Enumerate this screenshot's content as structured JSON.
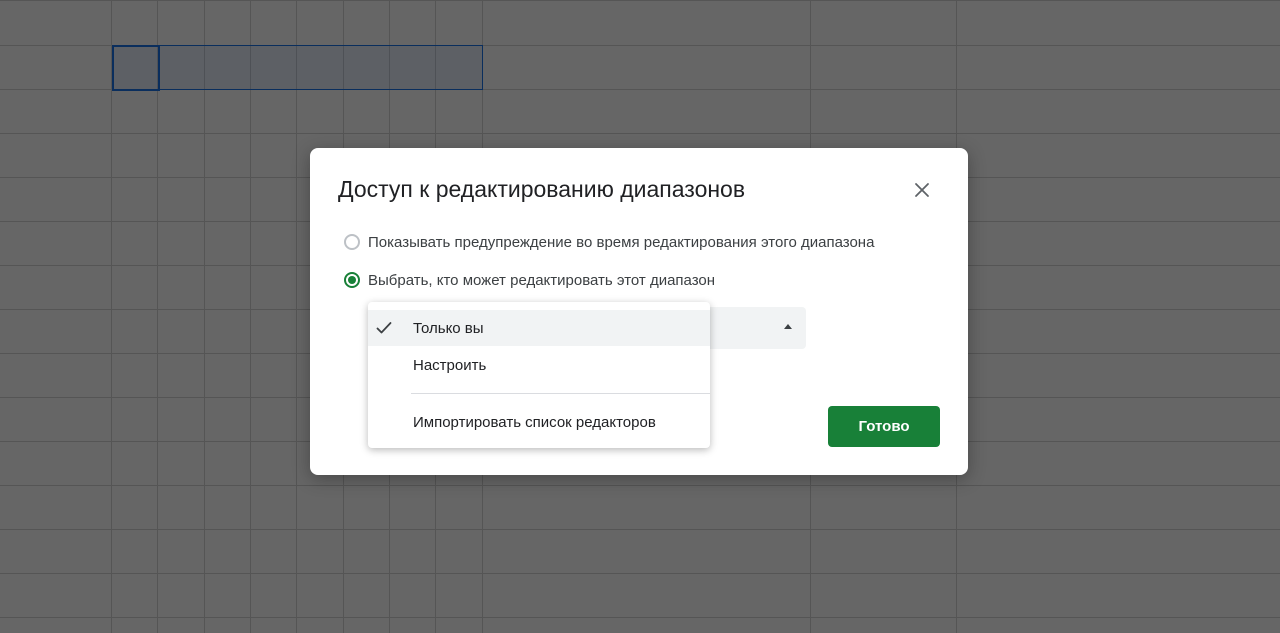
{
  "dialog": {
    "title": "Доступ к редактированию диапазонов",
    "option_warning_label": "Показывать предупреждение во время редактирования этого диапазона",
    "option_choose_label": "Выбрать, кто может редактировать этот диапазон",
    "selected_option": "option_choose",
    "done_label": "Готово"
  },
  "dropdown_menu": {
    "items": [
      {
        "label": "Только вы",
        "checked": true
      },
      {
        "label": "Настроить",
        "checked": false
      },
      {
        "label": "Импортировать список редакторов",
        "checked": false
      }
    ]
  },
  "icons": {
    "close": "close-icon",
    "check": "check-icon",
    "arrow": "arrow-up-icon"
  },
  "colors": {
    "accent_green": "#188038",
    "selection_blue": "#1a73e8"
  }
}
